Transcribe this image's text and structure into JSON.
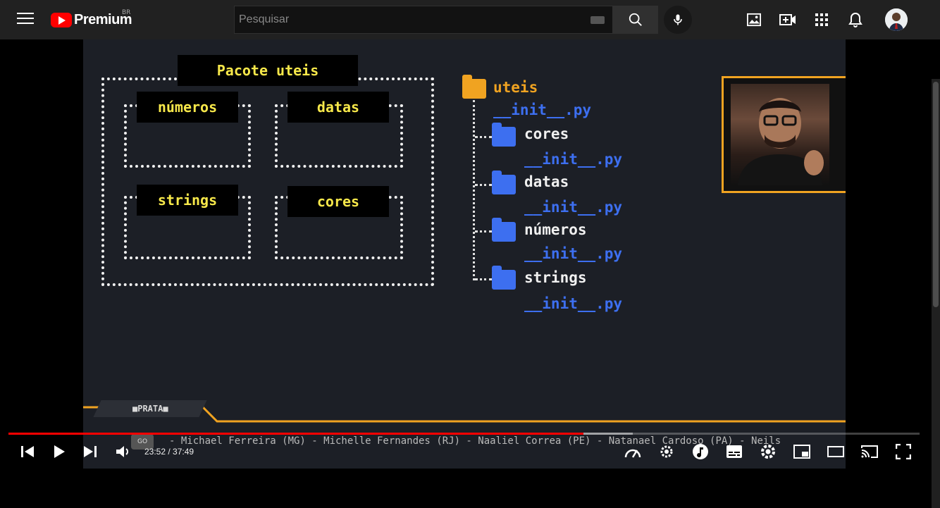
{
  "topbar": {
    "brand": "Premium",
    "region": "BR",
    "search_placeholder": "Pesquisar",
    "icons": [
      "menu-icon",
      "search-icon",
      "mic-icon",
      "image-icon",
      "create-video-icon",
      "apps-icon",
      "bell-icon"
    ]
  },
  "slide": {
    "package_title": "Pacote uteis",
    "modules": [
      "números",
      "datas",
      "strings",
      "cores"
    ],
    "tree": {
      "root": "uteis",
      "root_init": "__init__.py",
      "folders": [
        {
          "name": "cores",
          "init": "__init__.py"
        },
        {
          "name": "datas",
          "init": "__init__.py"
        },
        {
          "name": "números",
          "init": "__init__.py"
        },
        {
          "name": "strings",
          "init": "__init__.py"
        }
      ]
    },
    "rank_badge": "■PRATA■",
    "rank_icon_text": "GO",
    "ticker": "- Michael Ferreira (MG) - Michelle Fernandes (RJ) - Naaliel Correa (PE) - Natanael Cardoso (PA) - Neils"
  },
  "player": {
    "current_time": "23:52",
    "duration": "37:49",
    "time_display": "23:52 / 37:49",
    "progress": 0.631,
    "buffered": 0.685
  },
  "colors": {
    "accent_red": "#ff0000",
    "label_yellow": "#f7e84a",
    "folder_orange": "#f0a321",
    "folder_blue": "#3d6ff0"
  }
}
